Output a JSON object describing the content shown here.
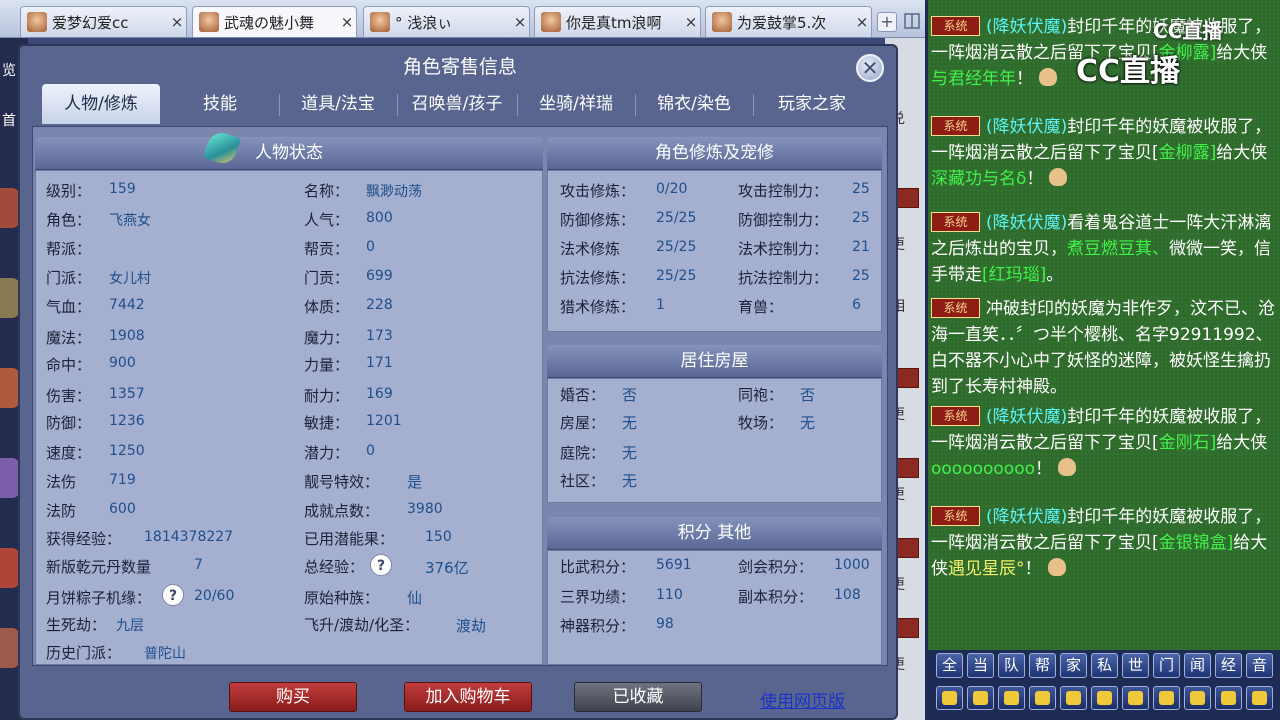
{
  "window_tabs": [
    {
      "title": "爱梦幻爱cc",
      "close": "×"
    },
    {
      "title": "武魂の魅小舞",
      "close": "×"
    },
    {
      "title": "° 浅浪ぃ",
      "close": "×"
    },
    {
      "title": "你是真tm浪啊",
      "close": "×"
    },
    {
      "title": "为爱鼓掌5.次",
      "close": "×"
    }
  ],
  "tab_plus": "+",
  "dialog": {
    "title": "角色寄售信息",
    "close": "✕",
    "tabs": [
      "人物/修炼",
      "技能",
      "道具/法宝",
      "召唤兽/孩子",
      "坐骑/祥瑞",
      "锦衣/染色",
      "玩家之家"
    ],
    "active_tab": "人物/修炼"
  },
  "person_status": {
    "title": "人物状态",
    "left": [
      {
        "label": "级别：",
        "value": "159"
      },
      {
        "label": "角色：",
        "value": "飞燕女"
      },
      {
        "label": "帮派：",
        "value": ""
      },
      {
        "label": "门派：",
        "value": "女儿村"
      },
      {
        "label": "气血：",
        "value": "7442"
      },
      {
        "label": "魔法：",
        "value": "1908"
      },
      {
        "label": "命中：",
        "value": "900"
      },
      {
        "label": "伤害：",
        "value": "1357"
      },
      {
        "label": "防御：",
        "value": "1236"
      },
      {
        "label": "速度：",
        "value": "1250"
      },
      {
        "label": "法伤",
        "value": "719"
      },
      {
        "label": "法防",
        "value": "600"
      },
      {
        "label": "获得经验：",
        "value": "1814378227"
      },
      {
        "label": "新版乾元丹数量",
        "value": "7"
      },
      {
        "label": "月饼粽子机缘：",
        "value": "20/60"
      },
      {
        "label": "生死劫：",
        "value": "九层"
      },
      {
        "label": "历史门派：",
        "value": "普陀山"
      }
    ],
    "right": [
      {
        "label": "名称：",
        "value": "飘渺动荡"
      },
      {
        "label": "人气：",
        "value": "800"
      },
      {
        "label": "帮贡：",
        "value": "0"
      },
      {
        "label": "门贡：",
        "value": "699"
      },
      {
        "label": "体质：",
        "value": "228"
      },
      {
        "label": "魔力：",
        "value": "173"
      },
      {
        "label": "力量：",
        "value": "171"
      },
      {
        "label": "耐力：",
        "value": "169"
      },
      {
        "label": "敏捷：",
        "value": "1201"
      },
      {
        "label": "潜力：",
        "value": "0"
      },
      {
        "label": "靓号特效：",
        "value": "是"
      },
      {
        "label": "成就点数：",
        "value": "3980"
      },
      {
        "label": "已用潜能果：",
        "value": "150"
      },
      {
        "label": "总经验：",
        "value": "376亿"
      },
      {
        "label": "原始种族：",
        "value": "仙"
      },
      {
        "label": "飞升/渡劫/化圣：",
        "value": "渡劫"
      }
    ],
    "help_icon": "?"
  },
  "cultivation": {
    "title": "角色修炼及宠修",
    "rows": [
      {
        "l1": "攻击修炼：",
        "v1": "0/20",
        "l2": "攻击控制力：",
        "v2": "25"
      },
      {
        "l1": "防御修炼：",
        "v1": "25/25",
        "l2": "防御控制力：",
        "v2": "25"
      },
      {
        "l1": "法术修炼",
        "v1": "25/25",
        "l2": "法术控制力：",
        "v2": "21"
      },
      {
        "l1": "抗法修炼：",
        "v1": "25/25",
        "l2": "抗法控制力：",
        "v2": "25"
      },
      {
        "l1": "猎术修炼：",
        "v1": "1",
        "l2": "育兽：",
        "v2": "6"
      }
    ]
  },
  "housing": {
    "title": "居住房屋",
    "rows": [
      {
        "l1": "婚否：",
        "v1": "否",
        "l2": "同袍：",
        "v2": "否"
      },
      {
        "l1": "房屋：",
        "v1": "无",
        "l2": "牧场：",
        "v2": "无"
      },
      {
        "l1": "庭院：",
        "v1": "无",
        "l2": "",
        "v2": ""
      },
      {
        "l1": "社区：",
        "v1": "无",
        "l2": "",
        "v2": ""
      }
    ]
  },
  "points": {
    "title": "积分 其他",
    "rows": [
      {
        "l1": "比武积分：",
        "v1": "5691",
        "l2": "剑会积分：",
        "v2": "1000"
      },
      {
        "l1": "三界功绩：",
        "v1": "110",
        "l2": "副本积分：",
        "v2": "108"
      },
      {
        "l1": "神器积分：",
        "v1": "98",
        "l2": "",
        "v2": ""
      }
    ]
  },
  "buttons": {
    "buy": "购买",
    "cart": "加入购物车",
    "favorited": "已收藏",
    "web": "使用网页版"
  },
  "chat": {
    "logo": "CC直播",
    "logo_small": "CC直播",
    "tag": "系统",
    "messages": [
      {
        "p1": "(降妖伏魔)",
        "p2": "封印千年的妖魔被收服了，一阵烟消云散之后留下了宝贝[",
        "p3": "金柳露]",
        "p4": "给大侠",
        "p5": "与君经年年",
        "p6": "！"
      },
      {
        "p1": "(降妖伏魔)",
        "p2": "封印千年的妖魔被收服了，一阵烟消云散之后留下了宝贝[",
        "p3": "金柳露]",
        "p4": "给大侠",
        "p5": "深藏功与名δ",
        "p6": "！"
      },
      {
        "p1": "(降妖伏魔)",
        "p2": "看着鬼谷道士一阵大汗淋漓之后炼出的宝贝，",
        "p3": "煮豆燃豆萁、",
        "p4": "微微一笑，信手带走",
        "p5": "[红玛瑙]",
        "p6": "。"
      },
      {
        "p1": "",
        "p2": "冲破封印的妖魔为非作歹，汶不已、沧海一直笑．．〞つ半个樱桃、名字92911992、白不器不小心中了妖怪的迷障，被妖怪生擒扔到了长寿村神殿。",
        "p3": "",
        "p4": "",
        "p5": "",
        "p6": ""
      },
      {
        "p1": "(降妖伏魔)",
        "p2": "封印千年的妖魔被收服了，一阵烟消云散之后留下了宝贝[",
        "p3": "金刚石]",
        "p4": "给大侠",
        "p5": "oooooooooo",
        "p6": "！"
      },
      {
        "p1": "(降妖伏魔)",
        "p2": "封印千年的妖魔被收服了，一阵烟消云散之后留下了宝贝[",
        "p3": "金银锦盒]",
        "p4": "给大侠",
        "p5": "遇见星辰°",
        "p6": "！"
      }
    ]
  },
  "channels": [
    "全",
    "当",
    "队",
    "帮",
    "家",
    "私",
    "世",
    "门",
    "闻",
    "经",
    "音"
  ],
  "right_strip": [
    "兑",
    "更",
    "相",
    "贝",
    "更",
    "贝",
    "更",
    "贝",
    "更",
    "贝",
    "更"
  ],
  "left_edge": [
    "览",
    "首"
  ]
}
